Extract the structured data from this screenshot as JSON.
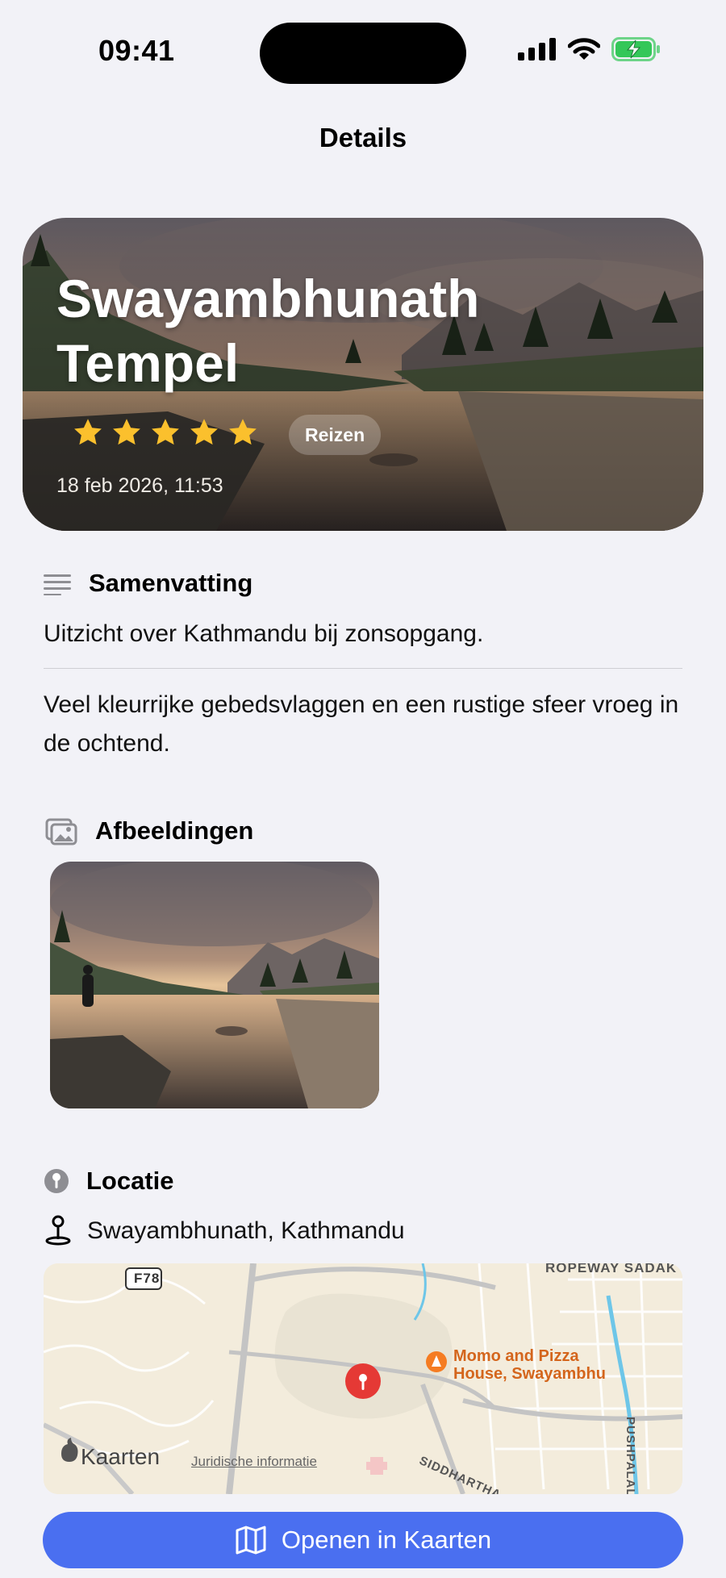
{
  "status_bar": {
    "time": "09:41"
  },
  "nav": {
    "title": "Details"
  },
  "hero": {
    "title": "Swayambhunath Tempel",
    "rating": 5,
    "rating_max": 5,
    "tag": "Reizen",
    "date": "18 feb 2026, 11:53"
  },
  "summary": {
    "heading": "Samenvatting",
    "short": "Uitzicht over Kathmandu bij zonsopgang.",
    "long": "Veel kleurrijke gebedsvlaggen en een rustige sfeer vroeg in de ochtend."
  },
  "images": {
    "heading": "Afbeeldingen"
  },
  "location": {
    "heading": "Locatie",
    "place": "Swayambhunath, Kathmandu",
    "map": {
      "road_badge": "F78",
      "street_top": "ROPEWAY SADAK",
      "poi_line1": "Momo and Pizza",
      "poi_line2": "House, Swayambhu",
      "street_bottom": "SIDDHARTHA SADAK",
      "street_right": "PUSHPALAL",
      "brand": "Kaarten",
      "legal": "Juridische informatie"
    }
  },
  "actions": {
    "open_in_maps": "Openen in Kaarten"
  },
  "colors": {
    "accent": "#4a6ff0",
    "star": "#fbc02d",
    "pin": "#e53935",
    "poi": "#f57c22"
  }
}
